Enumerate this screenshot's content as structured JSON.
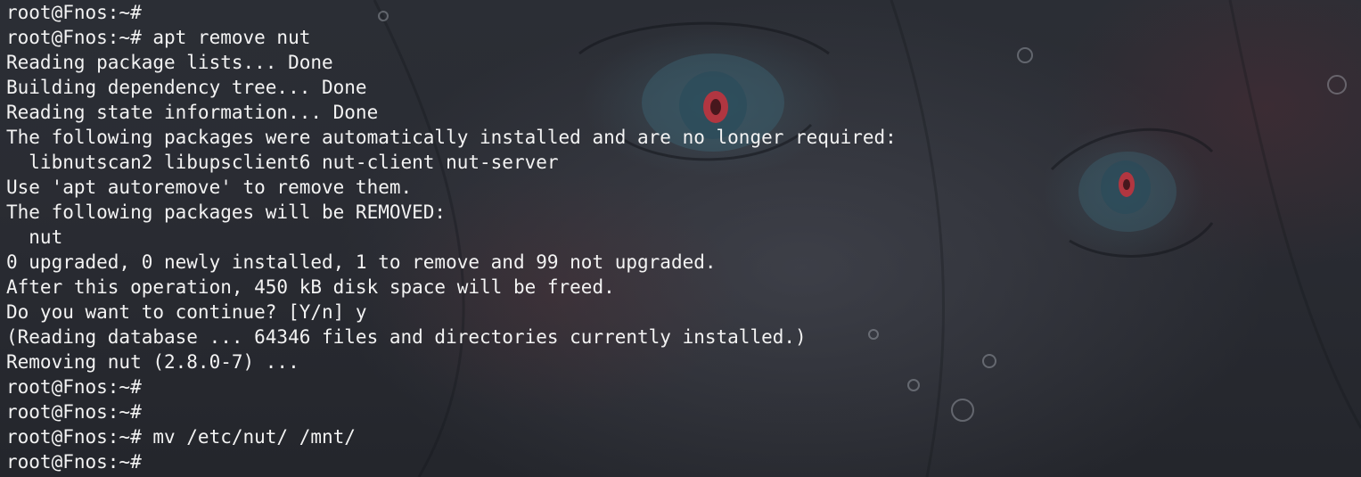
{
  "terminal": {
    "accent_color": "#f3f3f3",
    "background_color": "#2a2c33",
    "lines": [
      "root@Fnos:~#",
      "root@Fnos:~# apt remove nut",
      "Reading package lists... Done",
      "Building dependency tree... Done",
      "Reading state information... Done",
      "The following packages were automatically installed and are no longer required:",
      "  libnutscan2 libupsclient6 nut-client nut-server",
      "Use 'apt autoremove' to remove them.",
      "The following packages will be REMOVED:",
      "  nut",
      "0 upgraded, 0 newly installed, 1 to remove and 99 not upgraded.",
      "After this operation, 450 kB disk space will be freed.",
      "Do you want to continue? [Y/n] y",
      "(Reading database ... 64346 files and directories currently installed.)",
      "Removing nut (2.8.0-7) ...",
      "root@Fnos:~#",
      "root@Fnos:~#",
      "root@Fnos:~# mv /etc/nut/ /mnt/",
      "root@Fnos:~#"
    ]
  }
}
